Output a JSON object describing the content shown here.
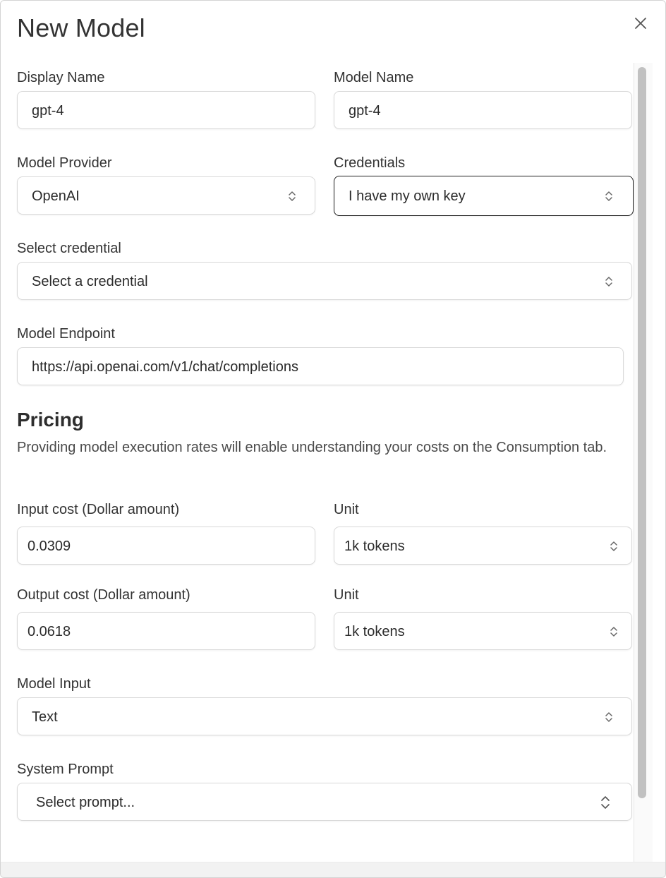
{
  "modal": {
    "title": "New Model"
  },
  "form": {
    "display_name": {
      "label": "Display Name",
      "value": "gpt-4"
    },
    "model_name": {
      "label": "Model Name",
      "value": "gpt-4"
    },
    "model_provider": {
      "label": "Model Provider",
      "value": "OpenAI"
    },
    "credentials": {
      "label": "Credentials",
      "value": "I have my own key"
    },
    "select_credential": {
      "label": "Select credential",
      "value": "Select a credential"
    },
    "model_endpoint": {
      "label": "Model Endpoint",
      "value": "https://api.openai.com/v1/chat/completions"
    }
  },
  "pricing": {
    "title": "Pricing",
    "description": "Providing model execution rates will enable understanding your costs on the Consumption tab.",
    "input_cost": {
      "label": "Input cost (Dollar amount)",
      "value": "0.0309"
    },
    "input_unit": {
      "label": "Unit",
      "value": "1k tokens"
    },
    "output_cost": {
      "label": "Output cost (Dollar amount)",
      "value": "0.0618"
    },
    "output_unit": {
      "label": "Unit",
      "value": "1k tokens"
    }
  },
  "model_input": {
    "label": "Model Input",
    "value": "Text"
  },
  "system_prompt": {
    "label": "System Prompt",
    "value": "Select prompt..."
  },
  "icons": {
    "close": "close-icon",
    "select_chevron": "chevron-up-down-icon"
  }
}
